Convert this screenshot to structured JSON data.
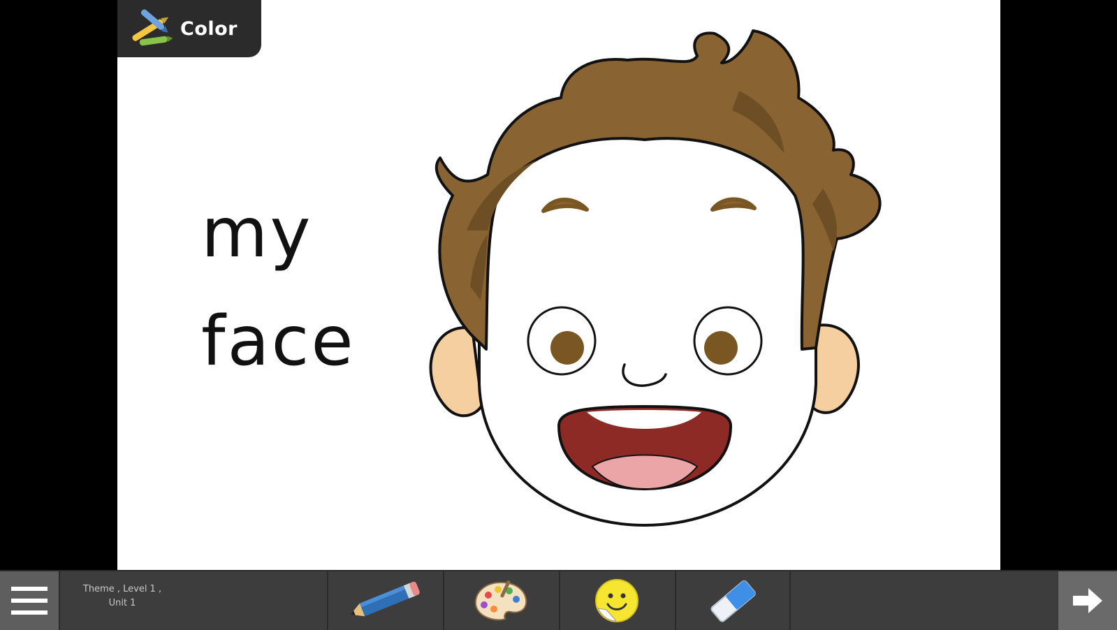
{
  "mode_tab": {
    "label": "Color",
    "icon": "crayons-icon"
  },
  "words": [
    "my",
    "face"
  ],
  "toolbar": {
    "breadcrumb_line1": "Theme , Level 1 ,",
    "breadcrumb_line2": "Unit 1",
    "menu_icon": "hamburger-menu-icon",
    "tools": [
      {
        "name": "pencil",
        "icon": "pencil-icon"
      },
      {
        "name": "palette",
        "icon": "paint-palette-icon"
      },
      {
        "name": "sticker",
        "icon": "smiley-sticker-icon"
      },
      {
        "name": "eraser",
        "icon": "eraser-icon"
      }
    ],
    "next_icon": "arrow-right-icon"
  },
  "colors": {
    "hair": "#8a6332",
    "hair_shadow": "#6e4e25",
    "eyes": "#7a5622",
    "ear": "#f6cfa1",
    "mouth": "#8e2a26",
    "tongue": "#eba5a6",
    "toolbar": "#3d3d3d"
  }
}
